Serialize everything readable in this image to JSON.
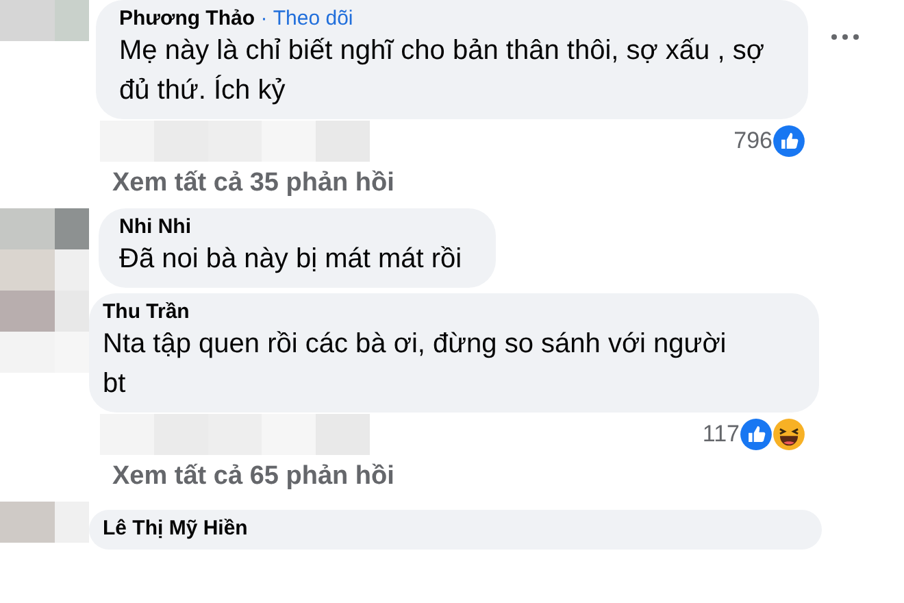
{
  "comments": [
    {
      "author": "Phương Thảo",
      "separator": "·",
      "follow": "Theo dõi",
      "text": "Mẹ này là chỉ biết nghĩ cho bản thân thôi, sợ xấu , sợ đủ thứ. Ích kỷ",
      "more_menu": true,
      "reaction_count": "796",
      "reactions": [
        {
          "kind": "like"
        }
      ],
      "replies_link": "Xem tất cả 35 phản hồi"
    },
    {
      "author": "Nhi Nhi",
      "text": "Đã noi bà này bị mát mát rồi"
    },
    {
      "author": "Thu Trần",
      "text": "Nta tập quen rồi các bà ơi, đừng so sánh với người bt",
      "reaction_count": "117",
      "reactions": [
        {
          "kind": "like"
        },
        {
          "kind": "haha"
        }
      ],
      "replies_link": "Xem tất cả 65 phản hồi"
    },
    {
      "author": "Lê Thị Mỹ Hiền"
    }
  ]
}
